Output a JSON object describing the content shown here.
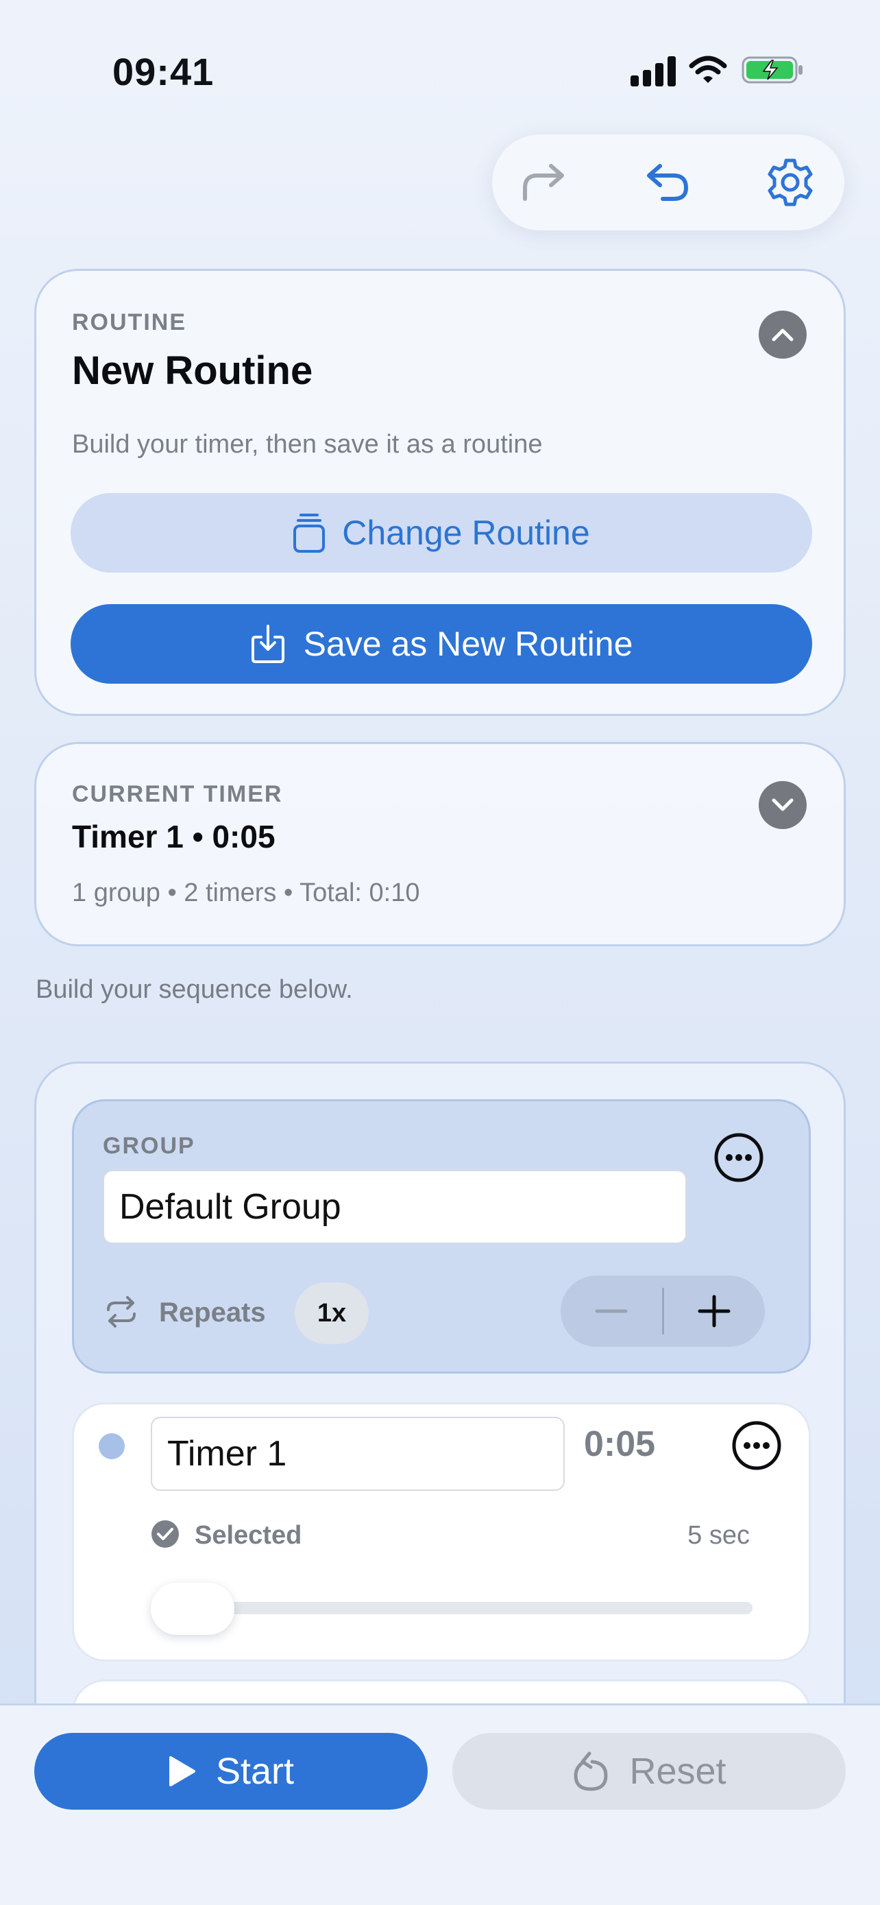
{
  "status_bar": {
    "time": "09:41",
    "icons": [
      "signal-icon",
      "wifi-icon",
      "battery-charging-icon"
    ]
  },
  "toolbar": {
    "icons": [
      "redo-icon",
      "undo-icon",
      "gear-icon"
    ]
  },
  "routine": {
    "section_label": "ROUTINE",
    "title": "New Routine",
    "subtitle": "Build your timer, then save it as a routine",
    "change_label": "Change Routine",
    "save_label": "Save as New Routine"
  },
  "current_timer": {
    "section_label": "CURRENT TIMER",
    "title": "Timer 1 • 0:05",
    "meta": "1 group • 2 timers • Total: 0:10"
  },
  "hint": "Build your sequence below.",
  "group": {
    "section_label": "GROUP",
    "name_value": "Default Group",
    "repeats_label": "Repeats",
    "repeats_value": "1x"
  },
  "timer_item": {
    "name_value": "Timer 1",
    "duration": "0:05",
    "selected_label": "Selected",
    "seconds_label": "5 sec",
    "slider_level": 0
  },
  "actions": {
    "start_label": "Start",
    "reset_label": "Reset"
  },
  "colors": {
    "accent": "#2d74d6",
    "accent_soft": "#cfdcf3",
    "muted": "#7a7f88",
    "battery_green": "#34c759"
  }
}
